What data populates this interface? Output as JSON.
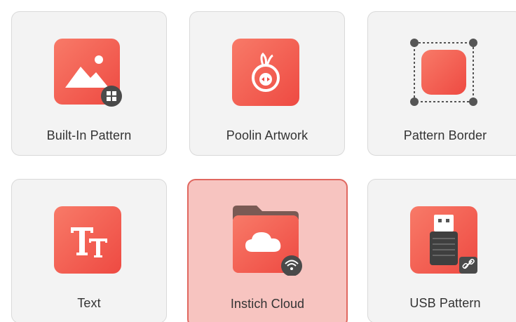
{
  "accent_color": "#f0584c",
  "selected_color": "#f7c4c0",
  "tiles": [
    {
      "id": "builtin",
      "label": "Built-In Pattern",
      "icon": "image-icon",
      "badge": "windows-icon",
      "selected": false
    },
    {
      "id": "poolin",
      "label": "Poolin Artwork",
      "icon": "poolin-logo-icon",
      "selected": false
    },
    {
      "id": "border",
      "label": "Pattern Border",
      "icon": "pattern-border-icon",
      "selected": false
    },
    {
      "id": "text",
      "label": "Text",
      "icon": "text-icon",
      "selected": false
    },
    {
      "id": "cloud",
      "label": "Instich Cloud",
      "icon": "cloud-folder-icon",
      "badge": "wifi-icon",
      "selected": true
    },
    {
      "id": "usb",
      "label": "USB Pattern",
      "icon": "usb-drive-icon",
      "badge": "link-icon",
      "selected": false
    }
  ]
}
